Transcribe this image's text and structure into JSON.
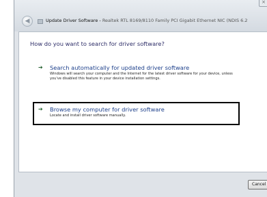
{
  "window": {
    "title_prefix": "Update Driver Software -",
    "title_device": "Realtek RTL 8169/8110 Family PCI Gigabit Ethernet NIC (NDIS 6.2",
    "close_glyph": "×",
    "back_glyph": "◀"
  },
  "main": {
    "heading": "How do you want to search for driver software?",
    "options": [
      {
        "title": "Search automatically for updated driver software",
        "description": "Windows will search your computer and the Internet for the latest driver software for your device, unless you've disabled this feature in your device installation settings.",
        "arrow_glyph": "➔"
      },
      {
        "title": "Browse my computer for driver software",
        "description": "Locate and install driver software manually.",
        "arrow_glyph": "➔"
      }
    ]
  },
  "footer": {
    "cancel_label": "Cancel"
  }
}
